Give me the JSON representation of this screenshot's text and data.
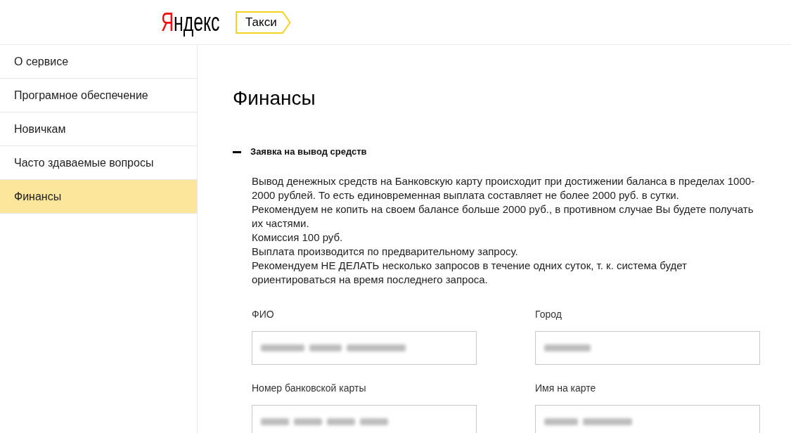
{
  "header": {
    "logo": "Яндекс",
    "service_tab": "Такси"
  },
  "sidebar": {
    "items": [
      {
        "label": "О сервисе",
        "selected": false
      },
      {
        "label": "Програмное обеспечение",
        "selected": false
      },
      {
        "label": "Новичкам",
        "selected": false
      },
      {
        "label": "Часто здаваемые вопросы",
        "selected": false
      },
      {
        "label": "Финансы",
        "selected": true
      }
    ]
  },
  "content": {
    "title": "Финансы",
    "section": {
      "title": "Заявка на вывод средств",
      "expanded": true,
      "description_lines": [
        "Вывод денежных средств на Банковскую карту происходит при достижении баланса в пределах 1000-",
        "2000 рублей. То есть единовременная выплата составляет не более 2000 руб. в сутки.",
        "Рекомендуем не копить на своем балансе больше 2000 руб., в противном случае Вы будете получать",
        "их частями.",
        "Комиссия 100 руб.",
        "Выплата производится по предварительному запросу.",
        "Рекомендуем НЕ ДЕЛАТЬ несколько запросов в течение одних суток, т. к. система будет",
        "ориентироваться на время последнего запроса."
      ],
      "fields": [
        {
          "label": "ФИО",
          "value_blurred": true
        },
        {
          "label": "Город",
          "value_blurred": true
        },
        {
          "label": "Номер банковской карты",
          "value_blurred": true
        },
        {
          "label": "Имя на карте",
          "value_blurred": true
        }
      ]
    }
  }
}
